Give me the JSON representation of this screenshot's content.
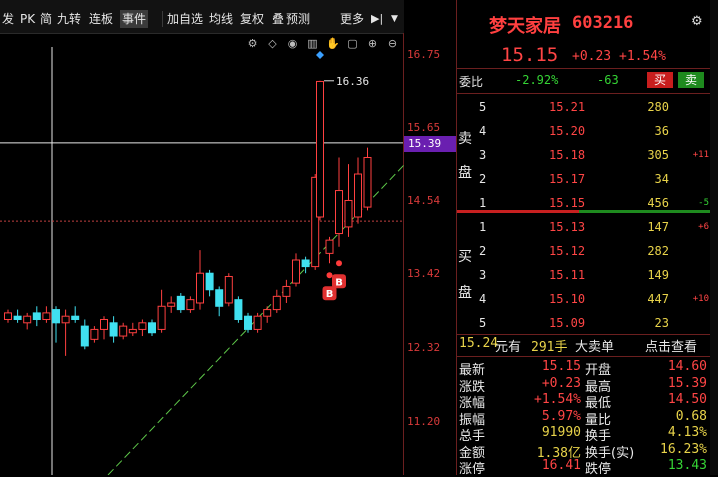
{
  "toolbar": {
    "items": [
      "发",
      "PK",
      "简",
      "九转",
      "连板",
      "事件",
      "加自选",
      "均线",
      "复权",
      "叠",
      "预测",
      "更多"
    ],
    "arrow": "▶|",
    "dropdown": "▼"
  },
  "chart": {
    "price_axis": [
      "16.75",
      "15.65",
      "14.54",
      "13.42",
      "12.32",
      "11.20"
    ],
    "current_price_tag": "15.39",
    "high_annotation": "16.36",
    "signal_label": "B",
    "candles": [
      {
        "o": 12.75,
        "c": 12.85,
        "h": 12.9,
        "l": 12.7
      },
      {
        "o": 12.8,
        "c": 12.75,
        "h": 12.9,
        "l": 12.7
      },
      {
        "o": 12.7,
        "c": 12.8,
        "h": 12.85,
        "l": 12.6
      },
      {
        "o": 12.85,
        "c": 12.75,
        "h": 12.95,
        "l": 12.65
      },
      {
        "o": 12.75,
        "c": 12.85,
        "h": 12.95,
        "l": 12.7
      },
      {
        "o": 12.9,
        "c": 12.7,
        "h": 12.95,
        "l": 12.4
      },
      {
        "o": 12.7,
        "c": 12.8,
        "h": 12.9,
        "l": 12.2
      },
      {
        "o": 12.8,
        "c": 12.75,
        "h": 12.95,
        "l": 12.7
      },
      {
        "o": 12.65,
        "c": 12.35,
        "h": 12.75,
        "l": 12.3
      },
      {
        "o": 12.45,
        "c": 12.6,
        "h": 12.65,
        "l": 12.4
      },
      {
        "o": 12.6,
        "c": 12.75,
        "h": 12.8,
        "l": 12.45
      },
      {
        "o": 12.7,
        "c": 12.5,
        "h": 12.8,
        "l": 12.4
      },
      {
        "o": 12.5,
        "c": 12.65,
        "h": 12.7,
        "l": 12.45
      },
      {
        "o": 12.55,
        "c": 12.6,
        "h": 12.7,
        "l": 12.5
      },
      {
        "o": 12.6,
        "c": 12.7,
        "h": 12.75,
        "l": 12.5
      },
      {
        "o": 12.7,
        "c": 12.55,
        "h": 12.75,
        "l": 12.5
      },
      {
        "o": 12.6,
        "c": 12.95,
        "h": 13.2,
        "l": 12.55
      },
      {
        "o": 12.95,
        "c": 13.0,
        "h": 13.1,
        "l": 12.85
      },
      {
        "o": 13.1,
        "c": 12.9,
        "h": 13.15,
        "l": 12.85
      },
      {
        "o": 12.9,
        "c": 13.05,
        "h": 13.1,
        "l": 12.85
      },
      {
        "o": 13.0,
        "c": 13.45,
        "h": 13.8,
        "l": 12.9
      },
      {
        "o": 13.45,
        "c": 13.2,
        "h": 13.5,
        "l": 13.1
      },
      {
        "o": 13.2,
        "c": 12.95,
        "h": 13.25,
        "l": 12.8
      },
      {
        "o": 13.0,
        "c": 13.4,
        "h": 13.45,
        "l": 12.95
      },
      {
        "o": 13.05,
        "c": 12.75,
        "h": 13.1,
        "l": 12.7
      },
      {
        "o": 12.8,
        "c": 12.6,
        "h": 12.85,
        "l": 12.55
      },
      {
        "o": 12.6,
        "c": 12.8,
        "h": 12.85,
        "l": 12.55
      },
      {
        "o": 12.8,
        "c": 12.9,
        "h": 12.95,
        "l": 12.7
      },
      {
        "o": 12.9,
        "c": 13.1,
        "h": 13.2,
        "l": 12.85
      },
      {
        "o": 13.1,
        "c": 13.25,
        "h": 13.35,
        "l": 13.0
      },
      {
        "o": 13.3,
        "c": 13.65,
        "h": 13.75,
        "l": 13.25
      },
      {
        "o": 13.65,
        "c": 13.55,
        "h": 13.7,
        "l": 13.45
      },
      {
        "o": 13.55,
        "c": 14.9,
        "h": 14.95,
        "l": 13.5
      },
      {
        "o": 14.3,
        "c": 16.35,
        "h": 16.36,
        "l": 14.25
      },
      {
        "o": 13.75,
        "c": 13.95,
        "h": 14.0,
        "l": 13.6
      },
      {
        "o": 14.05,
        "c": 14.7,
        "h": 15.2,
        "l": 13.85
      },
      {
        "o": 14.15,
        "c": 14.55,
        "h": 15.1,
        "l": 14.0
      },
      {
        "o": 14.3,
        "c": 14.95,
        "h": 15.2,
        "l": 14.2
      },
      {
        "o": 14.45,
        "c": 15.2,
        "h": 15.35,
        "l": 14.4
      }
    ],
    "buy_signals": [
      {
        "index": 34,
        "price": 13.42
      },
      {
        "index": 35,
        "price": 13.6
      }
    ]
  },
  "quote": {
    "name": "梦天家居",
    "code": "603216",
    "price": "15.15",
    "change": "+0.23",
    "change_pct": "+1.54%",
    "weibi_label": "委比",
    "weibi_pct": "-2.92%",
    "weibi_diff": "-63",
    "buy_btn": "买",
    "sell_btn": "卖",
    "sell_label_1": "卖",
    "sell_label_2": "盘",
    "buy_label_1": "买",
    "buy_label_2": "盘",
    "sells": [
      {
        "level": "5",
        "price": "15.21",
        "vol": "280",
        "chg": ""
      },
      {
        "level": "4",
        "price": "15.20",
        "vol": "36",
        "chg": ""
      },
      {
        "level": "3",
        "price": "15.18",
        "vol": "305",
        "chg": "+11"
      },
      {
        "level": "2",
        "price": "15.17",
        "vol": "34",
        "chg": ""
      },
      {
        "level": "1",
        "price": "15.15",
        "vol": "456",
        "chg": "-5"
      }
    ],
    "buys": [
      {
        "level": "1",
        "price": "15.13",
        "vol": "147",
        "chg": "+6"
      },
      {
        "level": "2",
        "price": "15.12",
        "vol": "282",
        "chg": ""
      },
      {
        "level": "3",
        "price": "15.11",
        "vol": "149",
        "chg": ""
      },
      {
        "level": "4",
        "price": "15.10",
        "vol": "447",
        "chg": "+10"
      },
      {
        "level": "5",
        "price": "15.09",
        "vol": "23",
        "chg": ""
      }
    ],
    "bigorder_price": "15.24",
    "bigorder_unit": "元有",
    "bigorder_vol": "291手",
    "bigorder_type": "大卖单",
    "bigorder_link": "点击查看",
    "stats": [
      {
        "l1": "最新",
        "v1": "15.15",
        "c1": "red",
        "l2": "开盘",
        "v2": "14.60",
        "c2": "red"
      },
      {
        "l1": "涨跌",
        "v1": "+0.23",
        "c1": "red",
        "l2": "最高",
        "v2": "15.39",
        "c2": "red"
      },
      {
        "l1": "涨幅",
        "v1": "+1.54%",
        "c1": "red",
        "l2": "最低",
        "v2": "14.50",
        "c2": "red"
      },
      {
        "l1": "振幅",
        "v1": "5.97%",
        "c1": "red",
        "l2": "量比",
        "v2": "0.68",
        "c2": "yellow"
      },
      {
        "l1": "总手",
        "v1": "91990",
        "c1": "yellow",
        "l2": "换手",
        "v2": "4.13%",
        "c2": "yellow"
      },
      {
        "l1": "金额",
        "v1": "1.38亿",
        "c1": "yellow",
        "l2": "换手(实)",
        "v2": "16.23%",
        "c2": "yellow"
      },
      {
        "l1": "涨停",
        "v1": "16.41",
        "c1": "red",
        "l2": "跌停",
        "v2": "13.43",
        "c2": "green"
      }
    ]
  },
  "colors": {
    "up": "#ff4040",
    "down": "#40e0f0",
    "accent": "#6a1fb0",
    "trend": "#5ec84a"
  }
}
